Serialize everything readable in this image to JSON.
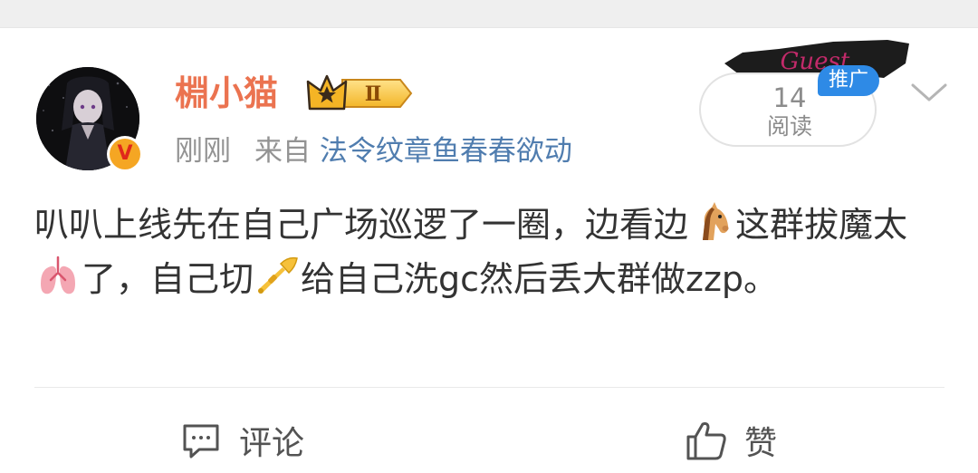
{
  "post": {
    "username": "棩小猫",
    "level_badge": "Ⅱ",
    "time": "刚刚",
    "source_prefix": "来自",
    "source_name": "法令纹章鱼春春欲动",
    "read_count": "14",
    "read_label": "阅读",
    "promo_label": "推广",
    "content_parts": {
      "p1": "叭叭上线先在自己广场巡逻了一圈，边看边",
      "p2": "这群拔魔太",
      "p3": "了，自己切",
      "p4": "给自己洗gc然后丢大群做zzp。"
    },
    "emojis": [
      "horse-emoji",
      "lungs-emoji",
      "trumpet-emoji"
    ]
  },
  "actions": {
    "comment_label": "评论",
    "like_label": "赞"
  },
  "colors": {
    "username": "#eb7350",
    "source_link": "#507daf",
    "meta_gray": "#939393",
    "promo_blue": "#2e8ae6"
  }
}
